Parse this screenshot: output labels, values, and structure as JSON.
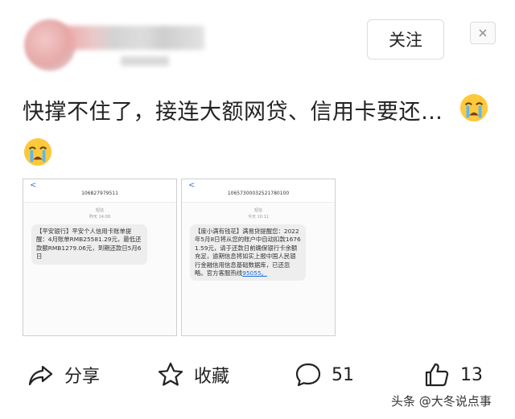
{
  "header": {
    "follow_label": "关注"
  },
  "post": {
    "text": "快撑不住了，接连大额网贷、信用卡要还…"
  },
  "screenshots": [
    {
      "back_label": "<",
      "sender": "10682797951​1",
      "kind_label": "短信",
      "time_label": "昨天 14:08",
      "message": "【平安银行】平安个人信用卡账单提醒：4月账单RMB25581.29元，最低还款额RMB1279.06元，到期还款日5月6日",
      "link": ""
    },
    {
      "back_label": "<",
      "sender": "10657300032521780100",
      "kind_label": "短信",
      "time_label": "今天 10:11",
      "message": "【度小满有钱花】满易贷提醒您：2022年5月8日将从您的账户中自动扣款16761.59元，请于还款日前确保银行卡余额充足，逾期信息将如实上报中国人民银行金融信用信息基础数据库，已还忽略。官方客服热线",
      "link": "95055。"
    }
  ],
  "actions": {
    "share_label": "分享",
    "favorite_label": "收藏",
    "comment_count": "51",
    "like_count": "13"
  },
  "watermark": "头条 @大冬说点事",
  "icons": {
    "close": "close-icon",
    "emoji": "crying-face-icon",
    "share": "share-icon",
    "favorite": "star-icon",
    "comment": "comment-icon",
    "like": "thumbs-up-icon"
  }
}
